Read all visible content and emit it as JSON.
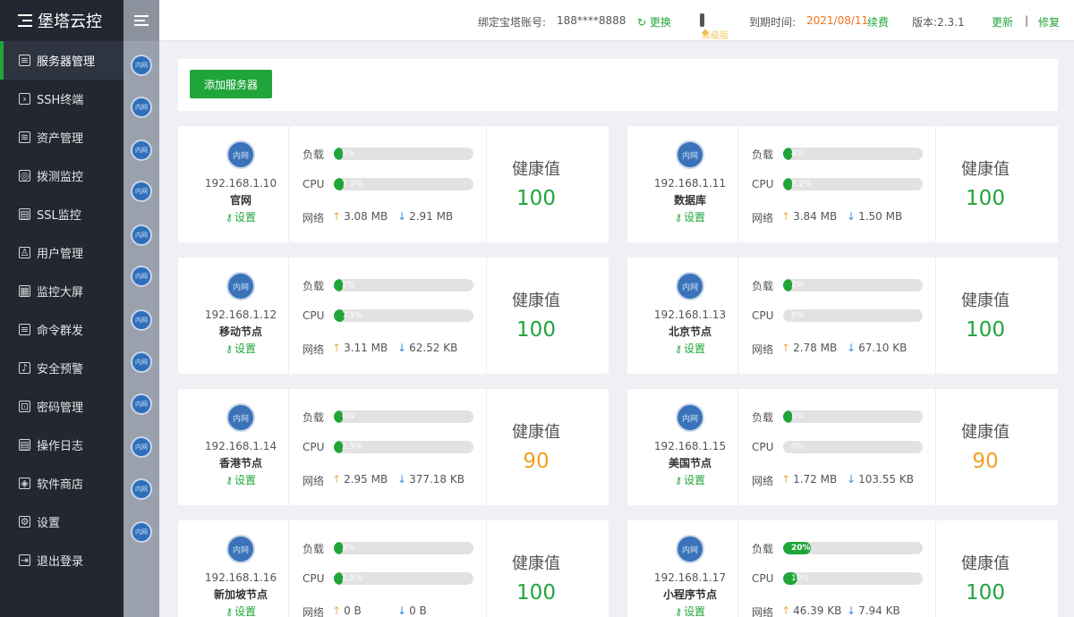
{
  "app": {
    "title": "堡塔云控"
  },
  "sidebar": {
    "items": [
      {
        "label": "服务器管理",
        "icon": "server-icon",
        "glyph": "≡",
        "active": true
      },
      {
        "label": "SSH终端",
        "icon": "terminal-icon",
        "glyph": "›"
      },
      {
        "label": "资产管理",
        "icon": "database-icon",
        "glyph": "≋"
      },
      {
        "label": "拨测监控",
        "icon": "globe-icon",
        "glyph": "◎"
      },
      {
        "label": "SSL监控",
        "icon": "certificate-icon",
        "glyph": "▤"
      },
      {
        "label": "用户管理",
        "icon": "user-icon",
        "glyph": "♙"
      },
      {
        "label": "监控大屏",
        "icon": "dashboard-icon",
        "glyph": "▦"
      },
      {
        "label": "命令群发",
        "icon": "command-icon",
        "glyph": "≡"
      },
      {
        "label": "安全预警",
        "icon": "bell-icon",
        "glyph": "♪"
      },
      {
        "label": "密码管理",
        "icon": "lock-icon",
        "glyph": "⊡"
      },
      {
        "label": "操作日志",
        "icon": "log-icon",
        "glyph": "▤"
      },
      {
        "label": "软件商店",
        "icon": "store-icon",
        "glyph": "◈"
      },
      {
        "label": "设置",
        "icon": "gear-icon",
        "glyph": "⚙"
      },
      {
        "label": "退出登录",
        "icon": "logout-icon",
        "glyph": "⇥"
      }
    ]
  },
  "rail": {
    "dot_label": "内网"
  },
  "header": {
    "account_label": "绑定宝塔账号:",
    "account_value": "188****8888",
    "change_label": "更换",
    "vip_label": "高级版",
    "expire_label": "到期时间:",
    "expire_value": "2021/08/11",
    "renew_label": "续费",
    "version_label": "版本:2.3.1",
    "update_label": "更新",
    "separator": "|",
    "repair_label": "修复"
  },
  "toolbar": {
    "add_server_label": "添加服务器"
  },
  "labels": {
    "load": "负载",
    "cpu": "CPU",
    "network": "网络",
    "health": "健康值",
    "settings": "设置",
    "intranet": "内网"
  },
  "servers": [
    {
      "ip": "192.168.1.10",
      "name": "官网",
      "load": 5,
      "load_text": "5%",
      "cpu": 7.3,
      "cpu_text": "7.3%",
      "up": "3.08 MB",
      "down": "2.91 MB",
      "health": "100",
      "health_level": "good"
    },
    {
      "ip": "192.168.1.11",
      "name": "数据库",
      "load": 4,
      "load_text": "4%",
      "cpu": 3.2,
      "cpu_text": "3.2%",
      "up": "3.84 MB",
      "down": "1.50 MB",
      "health": "100",
      "health_level": "good"
    },
    {
      "ip": "192.168.1.12",
      "name": "移动节点",
      "load": 2,
      "load_text": "2%",
      "cpu": 7.5,
      "cpu_text": "7.5%",
      "up": "3.11 MB",
      "down": "62.52 KB",
      "health": "100",
      "health_level": "good"
    },
    {
      "ip": "192.168.1.13",
      "name": "北京节点",
      "load": 2,
      "load_text": "2%",
      "cpu": 0,
      "cpu_text": "0%",
      "up": "2.78 MB",
      "down": "67.10 KB",
      "health": "100",
      "health_level": "good"
    },
    {
      "ip": "192.168.1.14",
      "name": "香港节点",
      "load": 6,
      "load_text": "6%",
      "cpu": 2.5,
      "cpu_text": "2.5%",
      "up": "2.95 MB",
      "down": "377.18 KB",
      "health": "90",
      "health_level": "warn"
    },
    {
      "ip": "192.168.1.15",
      "name": "美国节点",
      "load": 3,
      "load_text": "3%",
      "cpu": 0,
      "cpu_text": "0%",
      "up": "1.72 MB",
      "down": "103.55 KB",
      "health": "90",
      "health_level": "warn"
    },
    {
      "ip": "192.168.1.16",
      "name": "新加坡节点",
      "load": 3,
      "load_text": "3%",
      "cpu": 2.5,
      "cpu_text": "2.5%",
      "up": "0 B",
      "down": "0 B",
      "health": "100",
      "health_level": "good"
    },
    {
      "ip": "192.168.1.17",
      "name": "小程序节点",
      "load": 20,
      "load_text": "20%",
      "cpu": 10,
      "cpu_text": "10%",
      "up": "46.39 KB",
      "down": "7.94 KB",
      "health": "100",
      "health_level": "good"
    }
  ],
  "colors": {
    "accent": "#20a53a",
    "warn": "#f0a020",
    "expire": "#f0741d",
    "sidebar": "#222731"
  }
}
